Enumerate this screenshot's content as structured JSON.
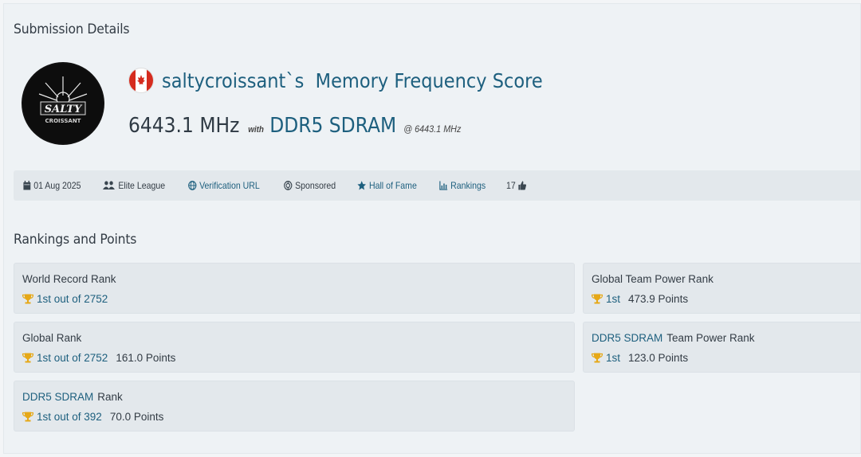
{
  "submission": {
    "section_title": "Submission Details",
    "username": "saltycroissant`s",
    "score_title": "Memory Frequency Score",
    "score_value": "6443.1 MHz",
    "with_label": "with",
    "hardware": "DDR5 SDRAM",
    "at_value": "@ 6443.1 MHz",
    "avatar_lines": [
      "SALTY",
      "CROISSANT"
    ],
    "country_flag": "canada-flag-icon"
  },
  "meta": {
    "date": "01 Aug 2025",
    "league": "Elite League",
    "verification": "Verification URL",
    "sponsored": "Sponsored",
    "hall_of_fame": "Hall of Fame",
    "rankings": "Rankings",
    "likes": "17"
  },
  "rankings": {
    "section_title": "Rankings and Points",
    "world_record": {
      "label": "World Record Rank",
      "rank": "1st out of 2752"
    },
    "global": {
      "label": "Global Rank",
      "rank": "1st out of 2752",
      "points": "161.0 Points"
    },
    "hw_rank": {
      "hw": "DDR5 SDRAM",
      "label": "Rank",
      "rank": "1st out of 392",
      "points": "70.0 Points"
    },
    "global_team": {
      "label": "Global Team Power Rank",
      "rank": "1st",
      "points": "473.9 Points"
    },
    "hw_team": {
      "hw": "DDR5 SDRAM",
      "label": "Team Power Rank",
      "rank": "1st",
      "points": "123.0 Points"
    }
  },
  "colors": {
    "accent": "#1d5f7e",
    "trophy": "#e6a817",
    "card_bg": "#e3e8ec"
  }
}
